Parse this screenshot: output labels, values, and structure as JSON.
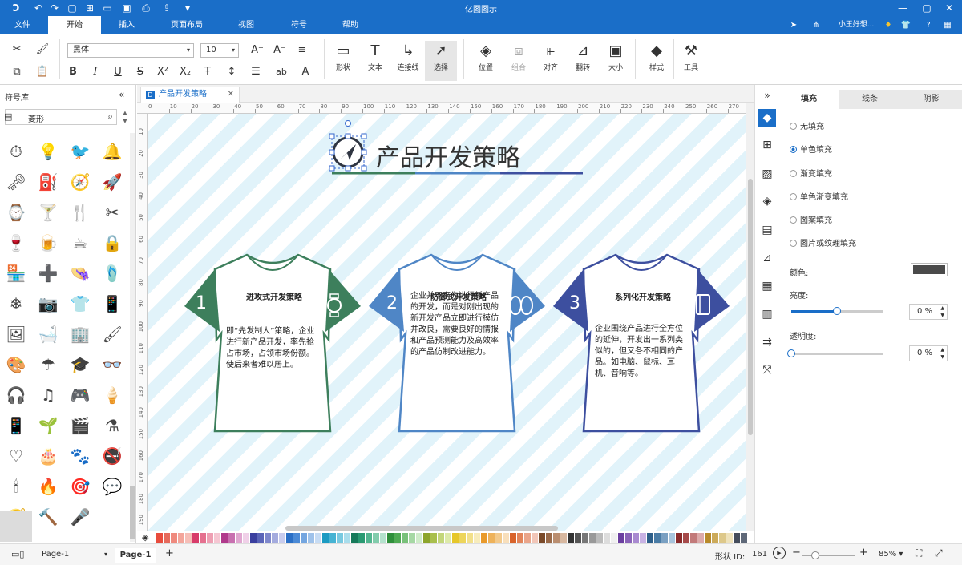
{
  "app": {
    "title": "亿图图示"
  },
  "menus": [
    "文件",
    "开始",
    "插入",
    "页面布局",
    "视图",
    "符号",
    "帮助"
  ],
  "active_menu": "开始",
  "user": {
    "name": "小王好想..."
  },
  "ribbon": {
    "font_family": "黑体",
    "font_size": "10",
    "tools": [
      {
        "key": "shape",
        "label": "形状"
      },
      {
        "key": "text",
        "label": "文本"
      },
      {
        "key": "connector",
        "label": "连接线"
      },
      {
        "key": "select",
        "label": "选择"
      },
      {
        "key": "position",
        "label": "位置"
      },
      {
        "key": "group",
        "label": "组合"
      },
      {
        "key": "align",
        "label": "对齐"
      },
      {
        "key": "flip",
        "label": "翻转"
      },
      {
        "key": "size",
        "label": "大小"
      },
      {
        "key": "style",
        "label": "样式"
      },
      {
        "key": "tools",
        "label": "工具"
      }
    ]
  },
  "library": {
    "title": "符号库",
    "search_value": "菱形"
  },
  "document": {
    "tab_title": "产品开发策略"
  },
  "ruler": {
    "h_ticks": [
      "0",
      "10",
      "20",
      "30",
      "40",
      "50",
      "60",
      "70",
      "80",
      "90",
      "100",
      "110",
      "120",
      "130",
      "140",
      "150",
      "160",
      "170",
      "180",
      "190",
      "200",
      "210",
      "220",
      "230",
      "240",
      "250",
      "260",
      "270",
      "280"
    ],
    "v_ticks": [
      "10",
      "20",
      "30",
      "40",
      "50",
      "60",
      "70",
      "80",
      "90",
      "100",
      "110",
      "120",
      "130",
      "140",
      "150",
      "160",
      "170",
      "180",
      "190"
    ]
  },
  "diagram": {
    "title": "产品开发策略",
    "shirts": [
      {
        "number": "1",
        "title": "进攻式开发策略",
        "body": "即“先发制人”策略，企业进行新产品开发，率先抢占市场，占领市场份额。使后来者难以居上。",
        "color": "#3d7f5c"
      },
      {
        "number": "2",
        "title": "防御式开发策略",
        "body": "企业并不率先进行新产品的开发，而是对刚出现的新开发产品立即进行模仿并改良，需要良好的情报和产品预测能力及高效率的产品仿制改进能力。",
        "color": "#4f86c6"
      },
      {
        "number": "3",
        "title": "系列化开发策略",
        "body": "企业围绕产品进行全方位的延伸，开发出一系列类似的，但又各不相同的产品。如电脑、鼠标、耳机、音响等。",
        "color": "#3d4f9f"
      }
    ]
  },
  "panel": {
    "tabs": [
      "填充",
      "线条",
      "阴影"
    ],
    "active_tab": "填充",
    "fill_options": [
      "无填充",
      "单色填充",
      "渐变填充",
      "单色渐变填充",
      "图案填充",
      "图片或纹理填充"
    ],
    "selected_fill": "单色填充",
    "color_label": "颜色:",
    "color_value": "#4a4a4a",
    "brightness_label": "亮度:",
    "brightness_value": "0 %",
    "brightness_level": 0.5,
    "transparency_label": "透明度:",
    "transparency_value": "0 %",
    "transparency_level": 0
  },
  "status": {
    "page_select": "Page-1",
    "page_tab": "Page-1",
    "shape_id_label": "形状 ID:",
    "shape_id": "161",
    "zoom": "85%"
  },
  "palette_colors": [
    "#e84c3d",
    "#e66a5c",
    "#ef8a7e",
    "#f3a59b",
    "#f6beb7",
    "#d83c6a",
    "#e5708f",
    "#ee9fb3",
    "#f5c6d2",
    "#b03a8c",
    "#c870b0",
    "#e0a6d0",
    "#f0d0e8",
    "#3a3f9f",
    "#5a64b8",
    "#7e87cc",
    "#a4abde",
    "#c8ccee",
    "#2a6fc6",
    "#4b8ad6",
    "#74a6e0",
    "#9fc2ea",
    "#c7dcf4",
    "#1c9bc2",
    "#46b3d3",
    "#78c9e0",
    "#a9ddec",
    "#177a5a",
    "#2a9a72",
    "#52b58f",
    "#82ccac",
    "#b4e2cd",
    "#2f8f3b",
    "#4faa53",
    "#79c17a",
    "#a6d8a4",
    "#cfecc9",
    "#8da52b",
    "#a9bf4d",
    "#c3d67a",
    "#ddeaa9",
    "#e6c72a",
    "#edd55a",
    "#f2e08a",
    "#f7ecbb",
    "#e99a2b",
    "#eeb25a",
    "#f3c98a",
    "#f8dfbb",
    "#d9632b",
    "#e2845a",
    "#eaa58a",
    "#f2c6b8",
    "#7a4a2a",
    "#9a6a4a",
    "#ba8e70",
    "#d8b8a0",
    "#333333",
    "#555555",
    "#777777",
    "#999999",
    "#bbbbbb",
    "#dddddd",
    "#f0f0f0",
    "#6b3fa0",
    "#8a63b8",
    "#a98ad0",
    "#c8b2e4",
    "#2d5f8a",
    "#4a7ca6",
    "#7aa0c2",
    "#a8c4dc",
    "#8a2a2a",
    "#a64a4a",
    "#c27a7a",
    "#dcaaaa",
    "#b88a2a",
    "#ccaa5a",
    "#ddc88a",
    "#eee2bb",
    "#444c5c",
    "#5e6878",
    "#7c8696",
    "#a0a8b4",
    "#c4cad2"
  ]
}
